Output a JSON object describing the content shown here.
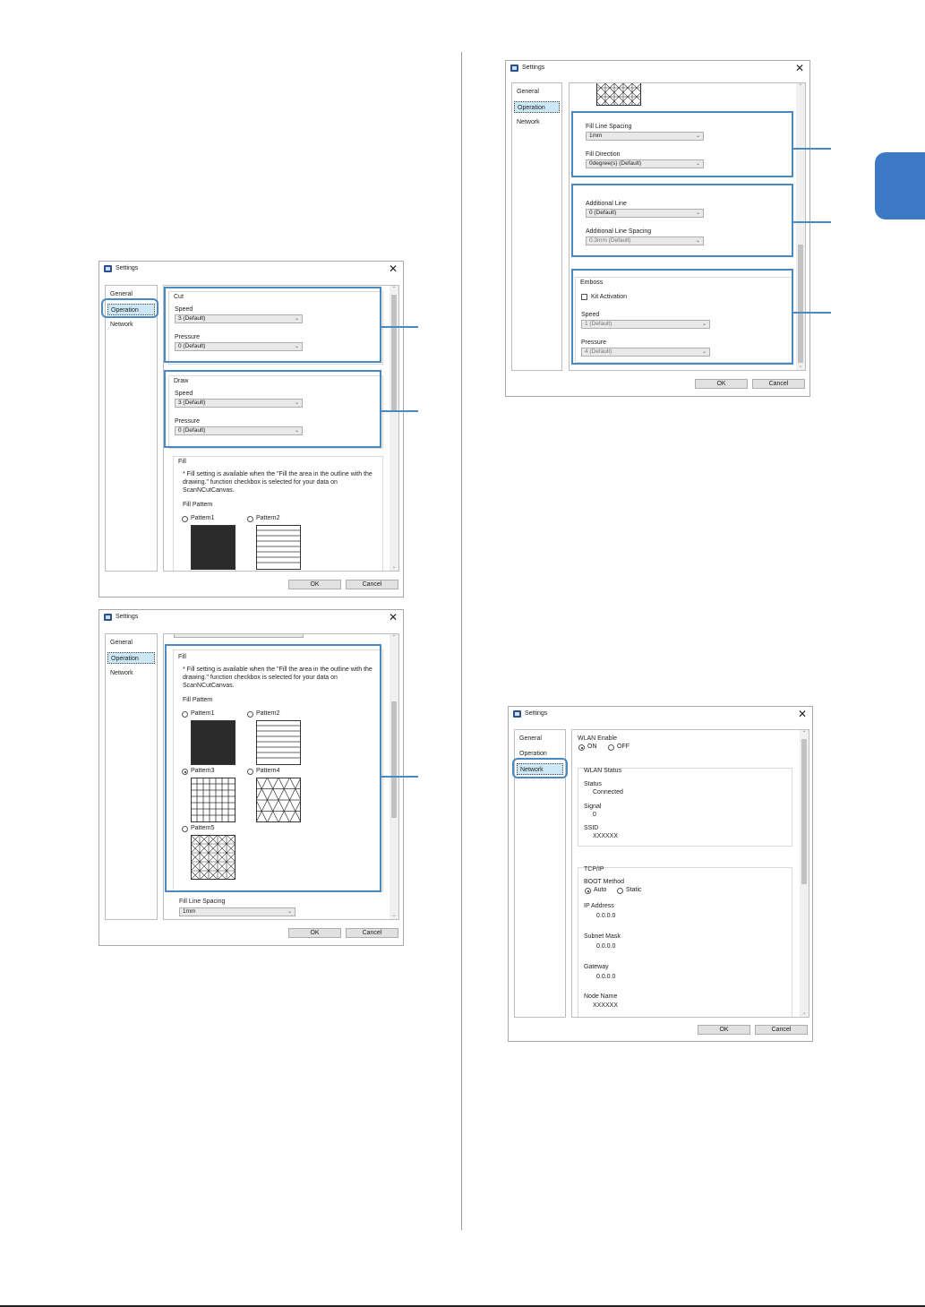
{
  "page": {
    "side_tab_color": "#3d78c4",
    "accent_color": "#4a88c6"
  },
  "dialog": {
    "title": "Settings",
    "close_icon": "close-icon",
    "nav": {
      "general": "General",
      "operation": "Operation",
      "network": "Network"
    },
    "ok": "OK",
    "cancel": "Cancel"
  },
  "cut": {
    "group": "Cut",
    "speed_label": "Speed",
    "speed_value": "3 (Default)",
    "pressure_label": "Pressure",
    "pressure_value": "0 (Default)"
  },
  "draw": {
    "group": "Draw",
    "speed_label": "Speed",
    "speed_value": "3 (Default)",
    "pressure_label": "Pressure",
    "pressure_value": "0 (Default)"
  },
  "fill": {
    "group": "Fill",
    "note": "* Fill setting is available when the \"Fill the area in the outline with the drawing.\" function  checkbox is selected for your data on ScanNCutCanvas.",
    "pattern_label": "Fill Pattern",
    "patterns": [
      "Pattern1",
      "Pattern2",
      "Pattern3",
      "Pattern4",
      "Pattern5"
    ],
    "selected_pattern": "Pattern3",
    "line_spacing_label": "Fill Line Spacing",
    "line_spacing_value": "1mm",
    "direction_label": "Fill Direction",
    "direction_value": "0degree(s) (Default)"
  },
  "additional": {
    "line_label": "Additional Line",
    "line_value": "0 (Default)",
    "spacing_label": "Additional Line Spacing",
    "spacing_value": "0.3mm (Default)"
  },
  "emboss": {
    "group": "Emboss",
    "kit_label": "Kit Activation",
    "speed_label": "Speed",
    "speed_value": "1 (Default)",
    "pressure_label": "Pressure",
    "pressure_value": "4 (Default)"
  },
  "network": {
    "wlan_enable_label": "WLAN Enable",
    "on": "ON",
    "off": "OFF",
    "wlan_status_group": "WLAN Status",
    "status_label": "Status",
    "status_value": "Connected",
    "signal_label": "Signal",
    "signal_value": "0",
    "ssid_label": "SSID",
    "ssid_value": "XXXXXX",
    "tcpip_group": "TCP/IP",
    "boot_label": "BOOT Method",
    "auto": "Auto",
    "static": "Static",
    "ip_label": "IP Address",
    "ip_value": "0.0.0.0",
    "subnet_label": "Subnet Mask",
    "subnet_value": "0.0.0.0",
    "gateway_label": "Gateway",
    "gateway_value": "0.0.0.0",
    "node_label": "Node Name",
    "node_value": "XXXXXX"
  }
}
